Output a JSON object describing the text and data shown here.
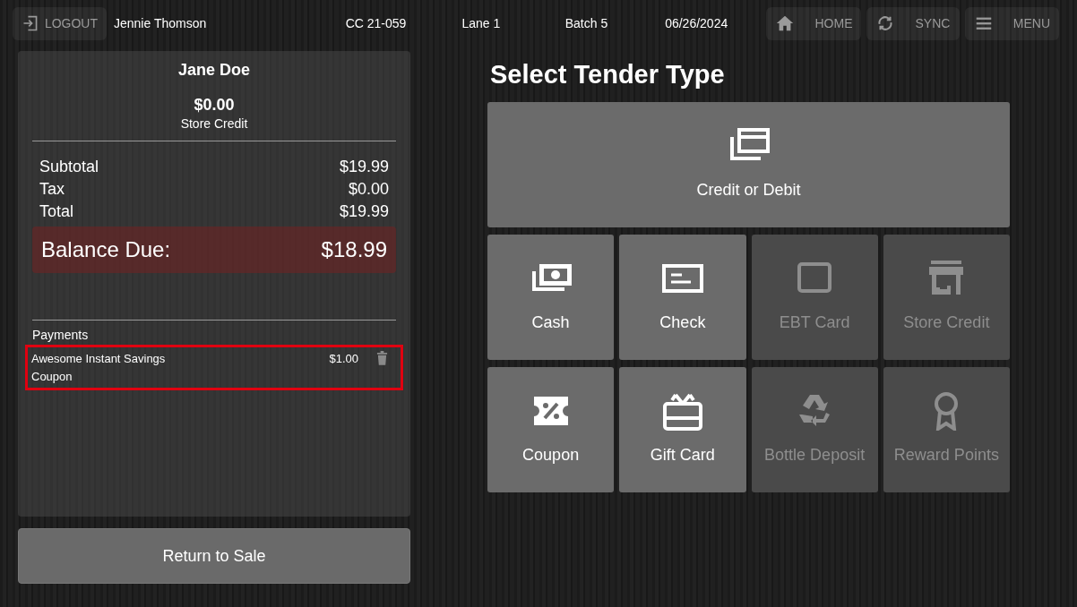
{
  "top_bar": {
    "logout": "LOGOUT",
    "user": "Jennie Thomson",
    "register": "CC 21-059",
    "lane": "Lane 1",
    "batch": "Batch 5",
    "date": "06/26/2024",
    "buttons": [
      {
        "kind": "home",
        "label": "HOME"
      },
      {
        "kind": "sync",
        "label": "SYNC"
      },
      {
        "kind": "menu",
        "label": "MENU"
      }
    ]
  },
  "customer": {
    "name": "Jane Doe",
    "credit_amount": "$0.00",
    "credit_label": "Store Credit"
  },
  "totals": [
    {
      "label": "Subtotal",
      "value": "$19.99"
    },
    {
      "label": "Tax",
      "value": "$0.00"
    },
    {
      "label": "Total",
      "value": "$19.99"
    }
  ],
  "balance": {
    "label": "Balance Due:",
    "value": "$18.99"
  },
  "payments": {
    "title": "Payments",
    "items": [
      {
        "name": "Awesome Instant Savings Coupon",
        "amount": "$1.00",
        "highlighted": true
      }
    ]
  },
  "return_button": "Return to Sale",
  "tender": {
    "title": "Select Tender Type",
    "options": [
      {
        "kind": "credit",
        "label": "Credit or Debit",
        "disabled": false
      },
      {
        "kind": "cash",
        "label": "Cash",
        "disabled": false
      },
      {
        "kind": "check",
        "label": "Check",
        "disabled": false
      },
      {
        "kind": "ebt",
        "label": "EBT Card",
        "disabled": true
      },
      {
        "kind": "store",
        "label": "Store Credit",
        "disabled": true
      },
      {
        "kind": "coupon",
        "label": "Coupon",
        "disabled": false
      },
      {
        "kind": "gift",
        "label": "Gift Card",
        "disabled": false
      },
      {
        "kind": "bottle",
        "label": "Bottle Deposit",
        "disabled": true
      },
      {
        "kind": "reward",
        "label": "Reward Points",
        "disabled": true
      }
    ]
  }
}
